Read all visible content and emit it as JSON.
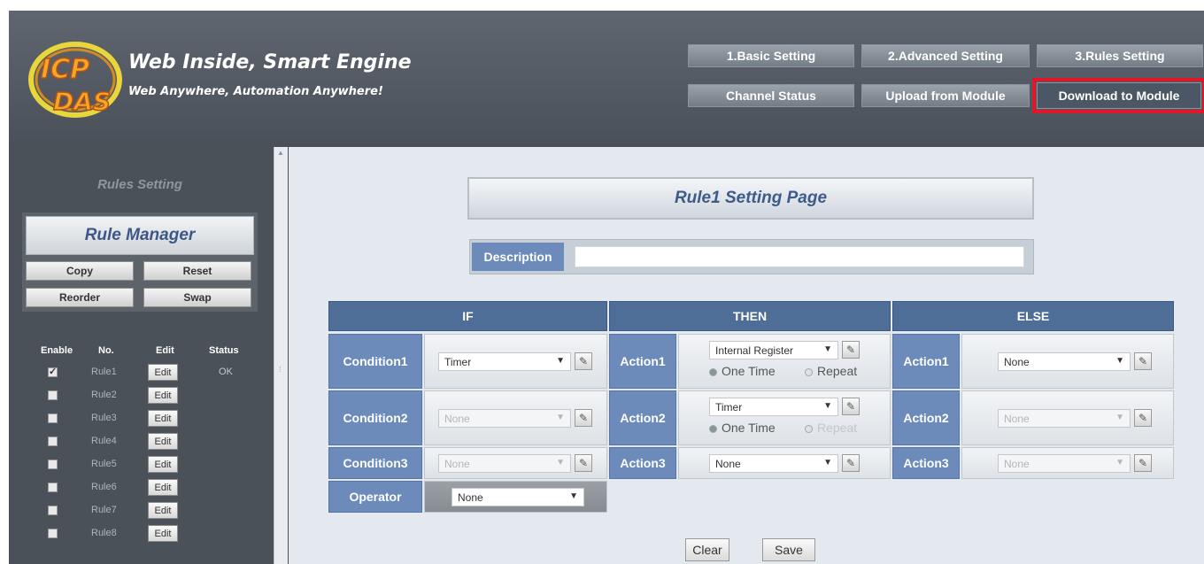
{
  "header": {
    "logo_text_top": "ICP",
    "logo_text_bottom": "DAS",
    "brand_title": "Web Inside, Smart Engine",
    "brand_subtitle": "Web Anywhere, Automation Anywhere!",
    "nav": {
      "basic": "1.Basic Setting",
      "advanced": "2.Advanced Setting",
      "rules": "3.Rules Setting",
      "channel": "Channel Status",
      "upload": "Upload from Module",
      "download": "Download to Module"
    },
    "highlight_color": "#e0162b"
  },
  "sidebar": {
    "title": "Rules Setting",
    "rule_manager": {
      "title": "Rule Manager",
      "copy": "Copy",
      "reset": "Reset",
      "reorder": "Reorder",
      "swap": "Swap"
    },
    "columns": {
      "enable": "Enable",
      "no": "No.",
      "edit": "Edit",
      "status": "Status"
    },
    "rules": [
      {
        "name": "Rule1",
        "enabled": true,
        "edit": "Edit",
        "status": "OK"
      },
      {
        "name": "Rule2",
        "enabled": false,
        "edit": "Edit",
        "status": ""
      },
      {
        "name": "Rule3",
        "enabled": false,
        "edit": "Edit",
        "status": ""
      },
      {
        "name": "Rule4",
        "enabled": false,
        "edit": "Edit",
        "status": ""
      },
      {
        "name": "Rule5",
        "enabled": false,
        "edit": "Edit",
        "status": ""
      },
      {
        "name": "Rule6",
        "enabled": false,
        "edit": "Edit",
        "status": ""
      },
      {
        "name": "Rule7",
        "enabled": false,
        "edit": "Edit",
        "status": ""
      },
      {
        "name": "Rule8",
        "enabled": false,
        "edit": "Edit",
        "status": ""
      }
    ]
  },
  "main": {
    "page_title": "Rule1 Setting Page",
    "description_label": "Description",
    "description_value": "",
    "columns": {
      "if": "IF",
      "then": "THEN",
      "else": "ELSE"
    },
    "if_rows": [
      {
        "label": "Condition1",
        "value": "Timer",
        "enabled": true
      },
      {
        "label": "Condition2",
        "value": "None",
        "enabled": false
      },
      {
        "label": "Condition3",
        "value": "None",
        "enabled": false
      }
    ],
    "operator": {
      "label": "Operator",
      "value": "None"
    },
    "then_rows": [
      {
        "label": "Action1",
        "value": "Internal Register",
        "one_time": "One Time",
        "repeat": "Repeat"
      },
      {
        "label": "Action2",
        "value": "Timer",
        "one_time": "One Time",
        "repeat": "Repeat"
      },
      {
        "label": "Action3",
        "value": "None"
      }
    ],
    "else_rows": [
      {
        "label": "Action1",
        "value": "None",
        "enabled": true
      },
      {
        "label": "Action2",
        "value": "None",
        "enabled": false
      },
      {
        "label": "Action3",
        "value": "None",
        "enabled": false
      }
    ],
    "clear": "Clear",
    "save": "Save"
  },
  "icons": {
    "edit": "edit-pencil-icon",
    "dropdown": "dropdown-arrow-icon",
    "scroll_up": "scroll-up-arrow-icon",
    "splitter": "splitter-grip-icon"
  }
}
